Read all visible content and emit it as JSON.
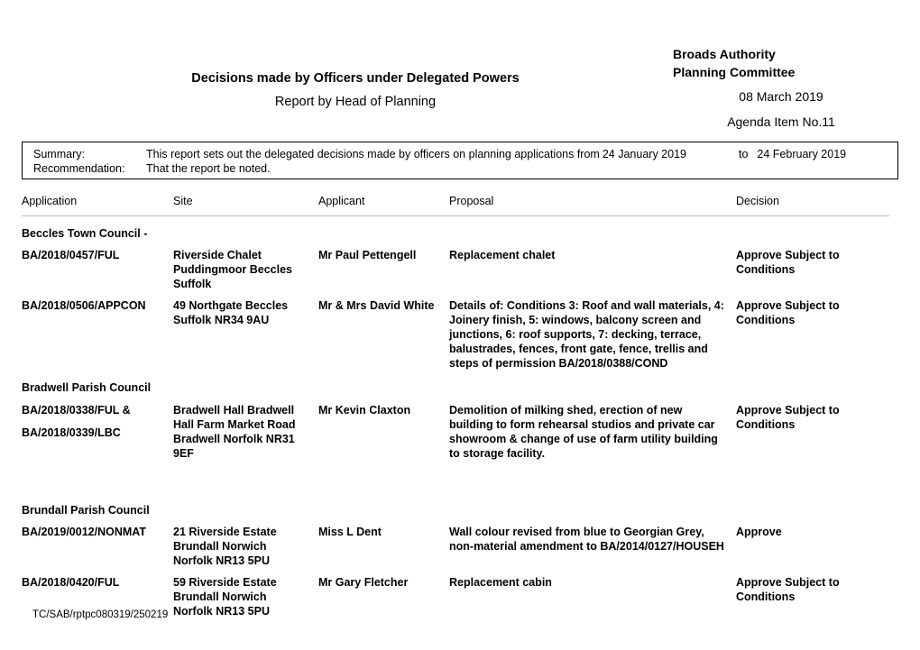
{
  "header": {
    "report_title": "Decisions made by Officers under Delegated Powers",
    "report_subtitle": "Report by Head of Planning",
    "committee_line1": "Broads Authority",
    "committee_line2": "Planning Committee",
    "committee_date": "08 March 2019",
    "agenda_item": "Agenda Item No.11"
  },
  "summary": {
    "summary_label": "Summary:",
    "summary_text": "This report sets out the delegated decisions made by officers on planning applications from",
    "from_date": "24 January 2019",
    "to_word": "to",
    "to_date": "24 February 2019",
    "recommendation_label": "Recommendation:",
    "recommendation_text": "That the report be noted."
  },
  "table": {
    "columns": {
      "application": "Application",
      "site": "Site",
      "applicant": "Applicant",
      "proposal": "Proposal",
      "decision": "Decision"
    },
    "groups": [
      {
        "heading": "Beccles Town Council -",
        "rows": [
          {
            "application": "BA/2018/0457/FUL",
            "application2": "",
            "site": "Riverside Chalet\nPuddingmoor Beccles\nSuffolk",
            "applicant": "Mr Paul Pettengell",
            "proposal": "Replacement chalet",
            "decision": "Approve Subject to Conditions"
          },
          {
            "application": "BA/2018/0506/APPCON",
            "application2": "",
            "site": "49 Northgate Beccles\nSuffolk NR34 9AU",
            "applicant": "Mr & Mrs David White",
            "proposal": "Details of: Conditions 3: Roof and wall materials, 4: Joinery finish, 5: windows, balcony screen and junctions, 6: roof supports, 7: decking, terrace, balustrades, fences, front gate, fence, trellis and steps of permission BA/2018/0388/COND",
            "decision": "Approve Subject to Conditions"
          }
        ]
      },
      {
        "heading": "Bradwell Parish Council",
        "rows": [
          {
            "application": "BA/2018/0338/FUL &",
            "application2": "BA/2018/0339/LBC",
            "site": "Bradwell Hall Bradwell\nHall Farm Market Road\nBradwell Norfolk NR31\n9EF",
            "applicant": "Mr Kevin Claxton",
            "proposal": "Demolition of milking shed, erection of new building to form rehearsal studios and private car showroom & change of use of farm utility building to storage facility.",
            "decision": "Approve Subject to Conditions"
          }
        ]
      },
      {
        "heading": "Brundall Parish Council",
        "rows": [
          {
            "application": "BA/2019/0012/NONMAT",
            "application2": "",
            "site": "21 Riverside Estate\nBrundall Norwich\nNorfolk NR13 5PU",
            "applicant": "Miss L Dent",
            "proposal": "Wall colour revised from blue to Georgian Grey, non-material amendment to BA/2014/0127/HOUSEH",
            "decision": "Approve"
          },
          {
            "application": "BA/2018/0420/FUL",
            "application2": "",
            "site": "59 Riverside Estate\nBrundall Norwich\nNorfolk NR13 5PU",
            "applicant": "Mr Gary Fletcher",
            "proposal": "Replacement cabin",
            "decision": "Approve Subject to Conditions"
          }
        ]
      }
    ]
  },
  "footer": {
    "reference": "TC/SAB/rptpc080319/250219"
  }
}
